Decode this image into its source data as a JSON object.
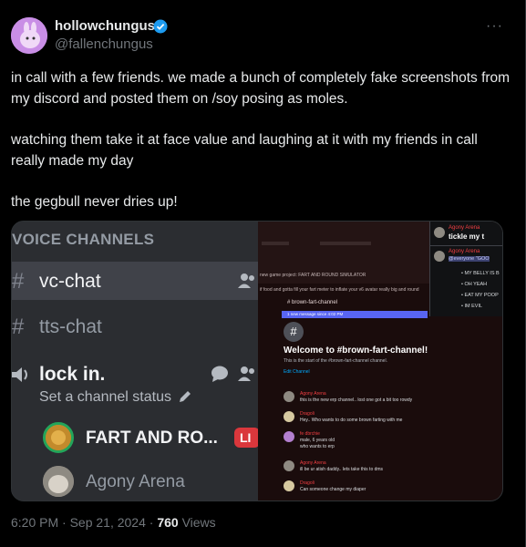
{
  "tweet": {
    "display_name": "hollowchungus",
    "handle": "@fallenchungus",
    "more_label": "···",
    "text": {
      "p1": "in call with a few friends. we made a bunch of completely fake screenshots from my discord and posted them on /soy posing as moles.",
      "p2": "watching them take it at face value and laughing at it with my friends in call really made my day",
      "p3": "the gegbull never dries up!"
    },
    "time": "6:20 PM · Sep 21, 2024 · ",
    "views_count": "760",
    "views_label": " Views"
  },
  "media": {
    "left": {
      "section_title": "VOICE CHANNELS",
      "channels": [
        {
          "icon": "#",
          "name": "vc-chat"
        },
        {
          "icon": "#",
          "name": "tts-chat"
        },
        {
          "icon": "speaker",
          "name": "lock in."
        }
      ],
      "status_placeholder": "Set a channel status",
      "users": [
        {
          "name": "FART AND RO...",
          "badge": "LI"
        },
        {
          "name": "Agony Arena"
        }
      ]
    },
    "right": {
      "top_small_1": "new game project: FART AND ROUND SIMULATOR",
      "top_small_2": "if food and gotta fill your fart meter to inflate your v6 avatar really big and round",
      "channel_name": "brown-fart-channel",
      "banner": "1 new message since 4:02 PM",
      "welcome": "Welcome to #brown-fart-channel!",
      "welcome_sub": "This is the start of the #brown-fart-channel channel.",
      "edit": "Edit Channel",
      "messages": [
        {
          "name": "Agony Arena",
          "line1": "this is the new erp channel.. lost one got a bit too rowdy",
          "line2": ""
        },
        {
          "name": "Dragoli",
          "line1": "Hey.. Who wants to do some brown farting with me",
          "line2": ""
        },
        {
          "name": "fe dbrchie",
          "line1": "male, 6 years old",
          "line2": "who wants to erp"
        },
        {
          "name": "Agony Arena",
          "line1": "ill be ur atish daddy.. lets take this to dms",
          "line2": ""
        },
        {
          "name": "Dragoli",
          "line1": "Can someone change my diaper",
          "line2": ""
        }
      ]
    },
    "overlay": {
      "name1": "Agony Arena",
      "text1": "tickle my t",
      "name2": "Agony Arena",
      "mention": "@everyone \"GOO",
      "bullets": [
        "MY BELLY IS B",
        "OH YEAH",
        "EAT MY POOP",
        "IM EVIL"
      ]
    }
  }
}
